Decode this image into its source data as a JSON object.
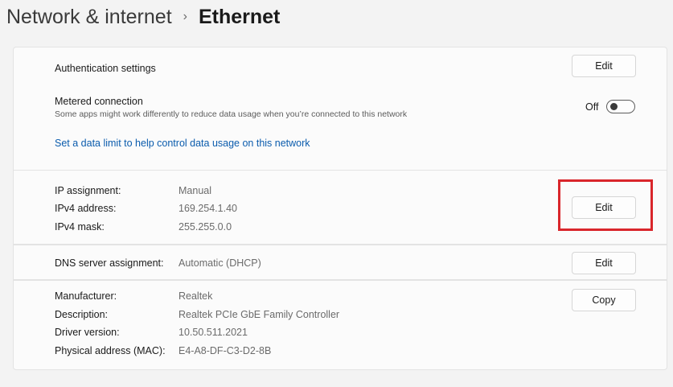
{
  "header": {
    "parent": "Network & internet",
    "separator": "›",
    "current": "Ethernet"
  },
  "auth": {
    "label": "Authentication settings",
    "button": "Edit"
  },
  "metered": {
    "title": "Metered connection",
    "description": "Some apps might work differently to reduce data usage when you’re connected to this network",
    "toggle_label": "Off",
    "toggle_state": false,
    "link": "Set a data limit to help control data usage on this network"
  },
  "ip": {
    "rows": [
      {
        "label": "IP assignment:",
        "value": "Manual"
      },
      {
        "label": "IPv4 address:",
        "value": "169.254.1.40"
      },
      {
        "label": "IPv4 mask:",
        "value": "255.255.0.0"
      }
    ],
    "button": "Edit"
  },
  "dns": {
    "label": "DNS server assignment:",
    "value": "Automatic (DHCP)",
    "button": "Edit"
  },
  "info": {
    "rows": [
      {
        "label": "Manufacturer:",
        "value": "Realtek"
      },
      {
        "label": "Description:",
        "value": "Realtek PCIe GbE Family Controller"
      },
      {
        "label": "Driver version:",
        "value": "10.50.511.2021"
      },
      {
        "label": "Physical address (MAC):",
        "value": "E4-A8-DF-C3-D2-8B"
      }
    ],
    "button": "Copy"
  },
  "colors": {
    "accent_link": "#0b5cad",
    "highlight_box": "#d9262b"
  }
}
